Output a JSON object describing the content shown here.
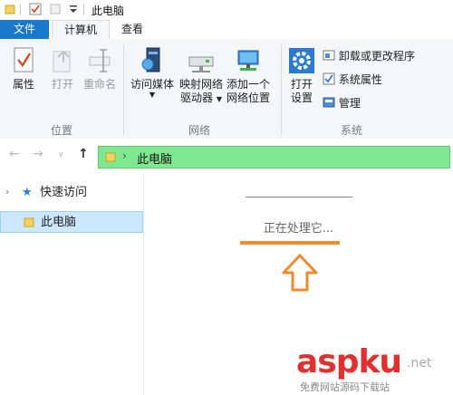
{
  "window": {
    "title": "此电脑"
  },
  "tabs": {
    "file": "文件",
    "computer": "计算机",
    "view": "查看"
  },
  "ribbon": {
    "location": {
      "properties": "属性",
      "open": "打开",
      "rename": "重命名",
      "group_label": "位置"
    },
    "network": {
      "access_media": "访问媒体",
      "map_drive_line1": "映射网络",
      "map_drive_line2": "驱动器",
      "add_location_line1": "添加一个",
      "add_location_line2": "网络位置",
      "group_label": "网络"
    },
    "system": {
      "open_settings_line1": "打开",
      "open_settings_line2": "设置",
      "uninstall": "卸载或更改程序",
      "system_properties": "系统属性",
      "manage": "管理",
      "group_label": "系统"
    }
  },
  "address": {
    "path": "此电脑"
  },
  "navpane": {
    "quick_access": "快速访问",
    "this_pc": "此电脑"
  },
  "content": {
    "status": "正在处理它..."
  },
  "watermark": {
    "brand": "aspku",
    "tld": ".net",
    "tagline": "免费网站源码下载站"
  },
  "colors": {
    "accent": "#1979ca",
    "address_bg": "#7fe88e",
    "highlight": "#f08a2e",
    "watermark": "#e03030"
  }
}
